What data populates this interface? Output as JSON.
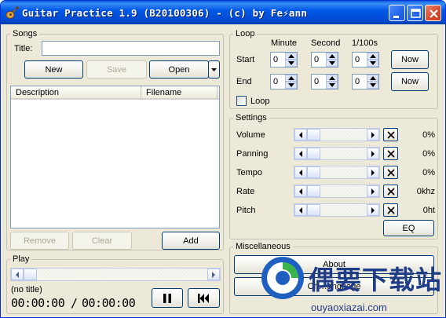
{
  "window": {
    "title": "Guitar Practice 1.9 (B20100306) - (c) by Fe⚡ann"
  },
  "songs": {
    "group_label": "Songs",
    "title_label": "Title:",
    "title_value": "",
    "new_label": "New",
    "save_label": "Save",
    "open_label": "Open",
    "columns": [
      "Description",
      "Filename"
    ],
    "remove_label": "Remove",
    "clear_label": "Clear",
    "add_label": "Add"
  },
  "play": {
    "group_label": "Play",
    "song_name": "(no title)",
    "position": "00:00:00",
    "separator": "/",
    "length": "00:00:00"
  },
  "loop": {
    "group_label": "Loop",
    "col_minute": "Minute",
    "col_second": "Second",
    "col_hundredths": "1/100s",
    "start_label": "Start",
    "end_label": "End",
    "start_minute": "0",
    "start_second": "0",
    "start_hundredths": "0",
    "end_minute": "0",
    "end_second": "0",
    "end_hundredths": "0",
    "now_label": "Now",
    "loop_checkbox_label": "Loop",
    "loop_checked": false
  },
  "settings": {
    "group_label": "Settings",
    "rows": [
      {
        "label": "Volume",
        "value": "0%"
      },
      {
        "label": "Panning",
        "value": "0%"
      },
      {
        "label": "Tempo",
        "value": "0%"
      },
      {
        "label": "Rate",
        "value": "0khz"
      },
      {
        "label": "Pitch",
        "value": "0ht"
      }
    ],
    "eq_label": "EQ"
  },
  "misc": {
    "group_label": "Miscellaneous",
    "about_label": "About",
    "second_button_label": "Ch…anguage"
  },
  "watermark": {
    "text": "偶要下载站",
    "url": "ouyaoxiazai.com"
  },
  "colors": {
    "titlebar": "#0058e6",
    "window_bg": "#ece9d8",
    "watermark": "#1f3c86"
  }
}
